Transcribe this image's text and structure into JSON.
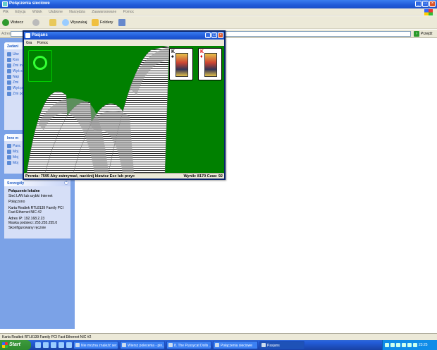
{
  "explorer": {
    "title": "Połączenia sieciowe",
    "menu": [
      "Plik",
      "Edycja",
      "Widok",
      "Ulubione",
      "Narzędzia",
      "Zaawansowane",
      "Pomoc"
    ],
    "toolbar": {
      "back": "Wstecz",
      "search": "Wyszukaj",
      "folders": "Foldery"
    },
    "address_label": "Adres",
    "go_label": "Przejdź",
    "status_text": "Karta Realtek RTL8139 Family PCI Fast Ethernet NIC #2"
  },
  "taskpane": {
    "panel1_title": "Zadani",
    "panel1_items": [
      "Utw",
      "Kon",
      "Zmi inst",
      "Wyś siec",
      "Nap",
      "Zmi",
      "Wyś poło",
      "Zmi poło"
    ],
    "panel2_title": "Inne m",
    "panel2_items": [
      "Panc",
      "Moj",
      "Moj",
      "Moj"
    ],
    "details": {
      "title": "Szczegóły",
      "name": "Połączenie lokalne",
      "type": "Sieć LAN lub szybki Internet",
      "state": "Połączono",
      "adapter": "Karta Realtek RTL8139 Family PCI Fast Ethernet NIC #2",
      "ip": "Adres IP: 192.168.2.23",
      "mask": "Maska podsieci: 255.255.255.0",
      "config": "Skonfigurowany ręcznie"
    }
  },
  "solitaire": {
    "title": "Pasjans",
    "menu": [
      "Gra",
      "Pomoc"
    ],
    "status_left": "Premia: 7595  Aby zatrzymać, naciśnij klawisz Esc lub przyc",
    "status_right": "Wynik: 8170 Czas: 92",
    "foundation": [
      {
        "rank": "K",
        "suit": "♠",
        "color": "#000000"
      },
      {
        "rank": "K",
        "suit": "♦",
        "color": "#dd0000"
      }
    ]
  },
  "taskbar": {
    "start_label": "Start",
    "tasks": [
      "Nie można znaleźć ser...",
      "Wiersz polecenia - pin...",
      "8. The Pussycat Dolls ...",
      "Połączenia sieciowe",
      "Pasjans"
    ],
    "clock": "23:25"
  }
}
